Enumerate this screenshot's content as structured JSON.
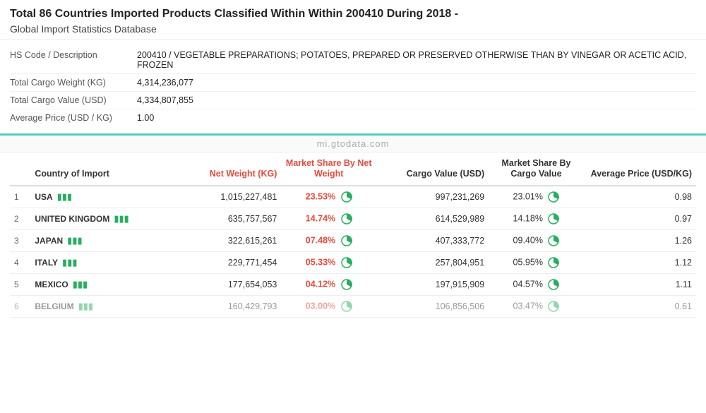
{
  "header": {
    "title_prefix": "Total 86 Countries Imported Products Classified Within Within 200410 During 2018",
    "title_suffix": " - ",
    "subtitle": "Global Import Statistics Database"
  },
  "info_rows": [
    {
      "label": "HS Code / Description",
      "value": "200410 / VEGETABLE PREPARATIONS; POTATOES, PREPARED OR PRESERVED OTHERWISE THAN BY VINEGAR OR ACETIC ACID, FROZEN"
    },
    {
      "label": "Total Cargo Weight (KG)",
      "value": "4,314,236,077"
    },
    {
      "label": "Total Cargo Value (USD)",
      "value": "4,334,807,855"
    },
    {
      "label": "Average Price (USD / KG)",
      "value": "1.00"
    }
  ],
  "watermark": "mi.gtodata.com",
  "table": {
    "headers": [
      {
        "label": "",
        "align": "left",
        "key": "rownum"
      },
      {
        "label": "Country of Import",
        "align": "left",
        "key": "country"
      },
      {
        "label": "Net Weight (KG)",
        "align": "right",
        "key": "netweight",
        "red": true
      },
      {
        "label": "Market Share By Net Weight",
        "align": "center",
        "key": "msnw",
        "red": true
      },
      {
        "label": "Cargo Value (USD)",
        "align": "right",
        "key": "cargovalue"
      },
      {
        "label": "Market Share By Cargo Value",
        "align": "center",
        "key": "mscv"
      },
      {
        "label": "Average Price (USD/KG)",
        "align": "right",
        "key": "avgprice"
      }
    ],
    "rows": [
      {
        "num": "1",
        "country": "USA",
        "netweight": "1,015,227,481",
        "msnw": "23.53%",
        "cargovalue": "997,231,269",
        "mscv": "23.01%",
        "avgprice": "0.98"
      },
      {
        "num": "2",
        "country": "UNITED KINGDOM",
        "netweight": "635,757,567",
        "msnw": "14.74%",
        "cargovalue": "614,529,989",
        "mscv": "14.18%",
        "avgprice": "0.97"
      },
      {
        "num": "3",
        "country": "JAPAN",
        "netweight": "322,615,261",
        "msnw": "07.48%",
        "cargovalue": "407,333,772",
        "mscv": "09.40%",
        "avgprice": "1.26"
      },
      {
        "num": "4",
        "country": "ITALY",
        "netweight": "229,771,454",
        "msnw": "05.33%",
        "cargovalue": "257,804,951",
        "mscv": "05.95%",
        "avgprice": "1.12"
      },
      {
        "num": "5",
        "country": "MEXICO",
        "netweight": "177,654,053",
        "msnw": "04.12%",
        "cargovalue": "197,915,909",
        "mscv": "04.57%",
        "avgprice": "1.11"
      },
      {
        "num": "6",
        "country": "BELGIUM",
        "netweight": "160,429,793",
        "msnw": "03.00%",
        "cargovalue": "106,856,506",
        "mscv": "03.47%",
        "avgprice": "0.61"
      }
    ]
  }
}
